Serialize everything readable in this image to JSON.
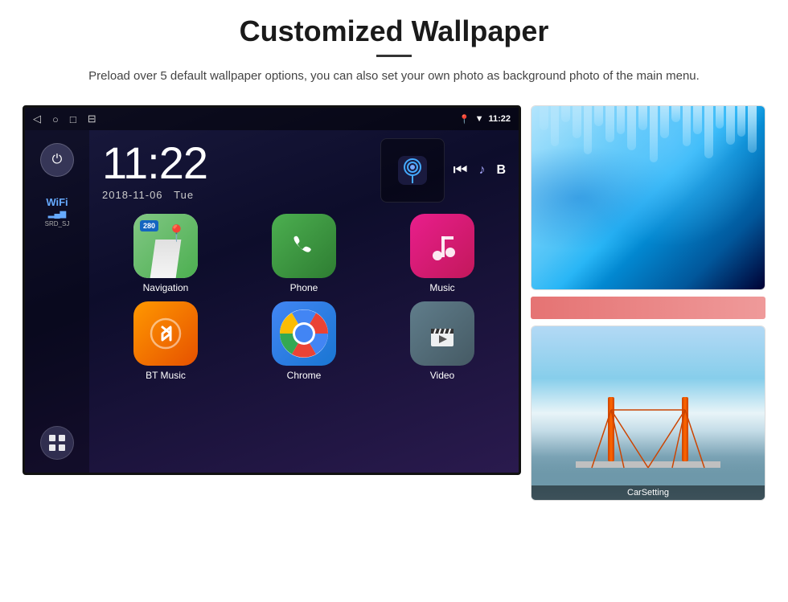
{
  "header": {
    "title": "Customized Wallpaper",
    "description": "Preload over 5 default wallpaper options, you can also set your own photo as background photo of the main menu."
  },
  "status_bar": {
    "nav_back": "◁",
    "nav_home": "○",
    "nav_recent": "□",
    "nav_screenshot": "⊟",
    "location_icon": "📍",
    "wifi_icon": "▼",
    "time": "11:22"
  },
  "sidebar": {
    "power_btn_label": "⏻",
    "wifi_label": "WiFi",
    "wifi_signal": "▂▄▆",
    "wifi_ssid": "SRD_SJ",
    "apps_btn_label": "⊞"
  },
  "clock": {
    "time": "11:22",
    "date": "2018-11-06",
    "day": "Tue"
  },
  "apps": [
    {
      "name": "Navigation",
      "type": "nav",
      "label": "Navigation"
    },
    {
      "name": "Phone",
      "type": "phone",
      "label": "Phone"
    },
    {
      "name": "Music",
      "type": "music",
      "label": "Music"
    },
    {
      "name": "BT Music",
      "type": "bt",
      "label": "BT Music"
    },
    {
      "name": "Chrome",
      "type": "chrome",
      "label": "Chrome"
    },
    {
      "name": "Video",
      "type": "video",
      "label": "Video"
    }
  ],
  "nav_badge": "280",
  "wallpapers": {
    "label1": "CarSetting"
  }
}
